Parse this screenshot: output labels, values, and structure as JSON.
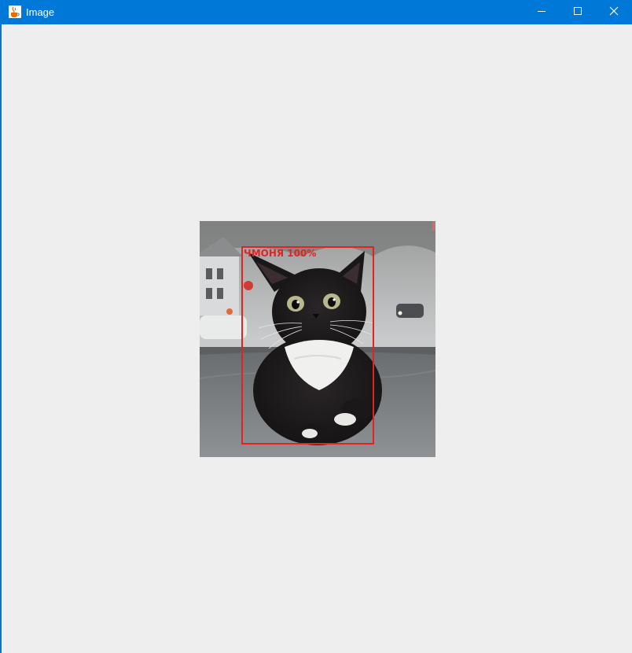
{
  "window": {
    "title": "Image",
    "icon": "java-cup-icon",
    "controls": [
      "minimize-icon",
      "maximize-icon",
      "close-icon"
    ],
    "colors": {
      "titlebar": "#0078d7",
      "client": "#eeeeee"
    }
  },
  "image": {
    "subject": "black-and-white kitten on car dashboard",
    "detection": {
      "label": "ЧМОНЯ 100%",
      "color": "#e52222"
    }
  }
}
